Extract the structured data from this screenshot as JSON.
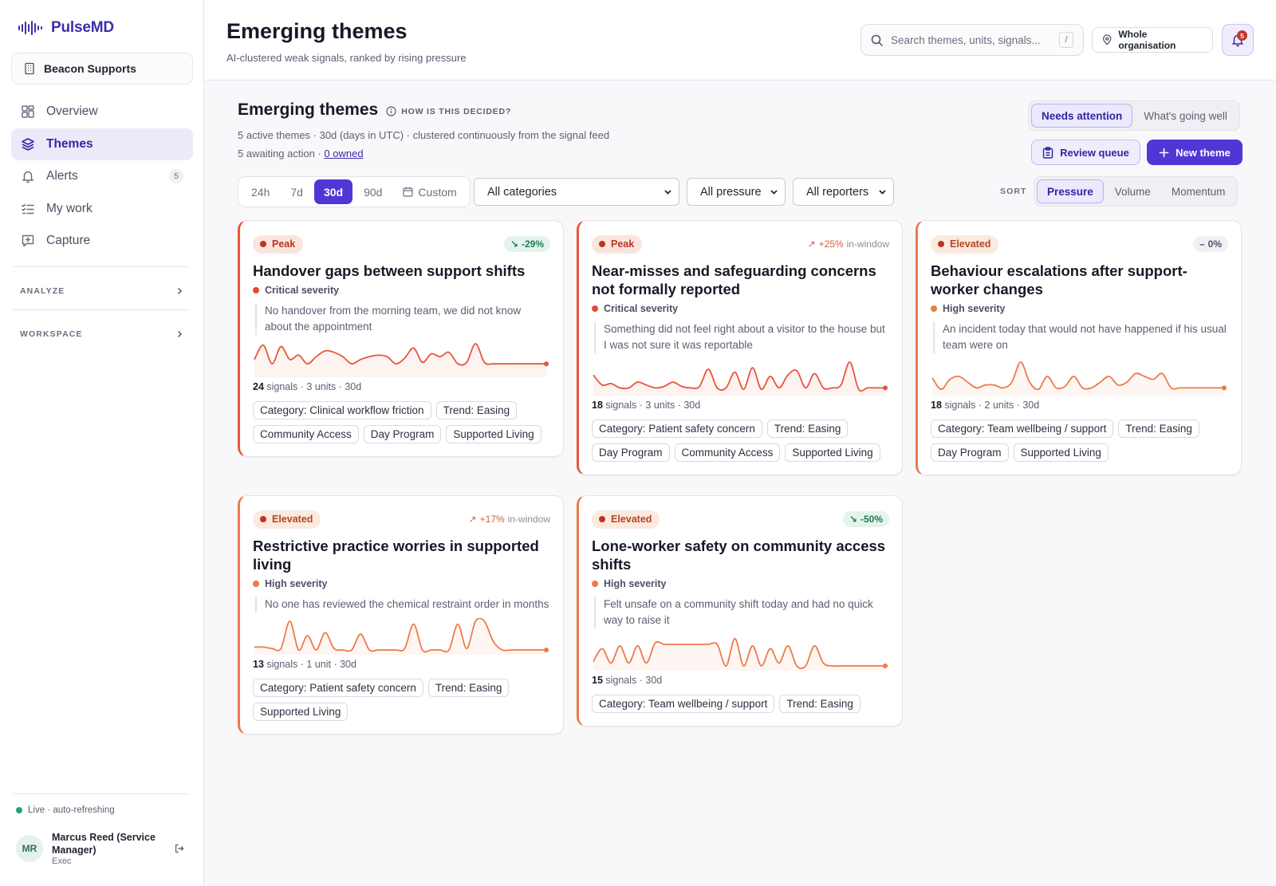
{
  "app": {
    "name": "PulseMD",
    "org": "Beacon Supports"
  },
  "sidebar": {
    "items": [
      {
        "label": "Overview",
        "icon": "dashboard-icon",
        "active": false
      },
      {
        "label": "Themes",
        "icon": "layers-icon",
        "active": true
      },
      {
        "label": "Alerts",
        "icon": "bell-icon",
        "badge": "5",
        "active": false
      },
      {
        "label": "My work",
        "icon": "checklist-icon",
        "active": false
      },
      {
        "label": "Capture",
        "icon": "message-plus-icon",
        "active": false
      }
    ],
    "sections": [
      "ANALYZE",
      "WORKSPACE"
    ],
    "live_status": "Live · auto-refreshing",
    "user": {
      "initials": "MR",
      "name": "Marcus Reed (Service Manager)",
      "role": "Exec"
    }
  },
  "header": {
    "title": "Emerging themes",
    "subtitle": "AI-clustered weak signals, ranked by rising pressure",
    "search_placeholder": "Search themes, units, signals...",
    "search_shortcut": "/",
    "scope": "Whole organisation",
    "notifications": "5"
  },
  "main": {
    "title": "Emerging themes",
    "how_link": "HOW IS THIS DECIDED?",
    "meta_line": "5 active themes · 30d (days in UTC) · clustered continuously from the signal feed",
    "awaiting": "5 awaiting action · ",
    "owned_link": "0 owned",
    "view_toggle": [
      "Needs attention",
      "What's going well"
    ],
    "review_button": "Review queue",
    "new_button": "New theme",
    "ranges": [
      "24h",
      "7d",
      "30d",
      "90d",
      "Custom"
    ],
    "active_range": "30d",
    "filters": {
      "category": "All categories",
      "pressure": "All pressure",
      "reporters": "All reporters"
    },
    "sort_label": "SORT",
    "sort_options": [
      "Pressure",
      "Volume",
      "Momentum"
    ]
  },
  "cards": [
    {
      "level": "Peak",
      "trend": "-29%",
      "trend_dir": "down",
      "title": "Handover gaps between support shifts",
      "severity": "Critical severity",
      "quote": "No handover from the morning team, we did not know about the appointment",
      "signals": "24",
      "stats_rest": " signals · 3 units · 30d",
      "tags": [
        "Category: Clinical workflow friction",
        "Trend: Easing",
        "Community Access",
        "Day Program",
        "Supported Living"
      ],
      "spark": [
        0.45,
        0.95,
        0.3,
        0.9,
        0.45,
        0.6,
        0.3,
        0.55,
        0.75,
        0.7,
        0.55,
        0.3,
        0.45,
        0.55,
        0.6,
        0.55,
        0.3,
        0.5,
        0.85,
        0.35,
        0.65,
        0.55,
        0.7,
        0.3,
        0.35,
        1.0,
        0.35,
        0.3,
        0.3,
        0.3,
        0.3,
        0.3,
        0.3,
        0.3
      ]
    },
    {
      "level": "Peak",
      "trend": "+25%",
      "trend_note": "in-window",
      "trend_dir": "up",
      "title": "Near-misses and safeguarding concerns not formally reported",
      "severity": "Critical severity",
      "quote": "Something did not feel right about a visitor to the house but I was not sure it was reportable",
      "signals": "18",
      "stats_rest": " signals · 3 units · 30d",
      "tags": [
        "Category: Patient safety concern",
        "Trend: Easing",
        "Day Program",
        "Community Access",
        "Supported Living"
      ],
      "spark": [
        0.55,
        0.2,
        0.25,
        0.1,
        0.1,
        0.3,
        0.2,
        0.1,
        0.15,
        0.3,
        0.15,
        0.1,
        0.15,
        0.75,
        0.1,
        0.1,
        0.65,
        0.05,
        0.8,
        0.05,
        0.5,
        0.1,
        0.55,
        0.7,
        0.1,
        0.6,
        0.1,
        0.1,
        0.2,
        1.0,
        0.05,
        0.1,
        0.1,
        0.1
      ]
    },
    {
      "level": "Elevated",
      "trend": "0%",
      "trend_dir": "flat",
      "title": "Behaviour escalations after support-worker changes",
      "severity": "High severity",
      "quote": "An incident today that would not have happened if his usual team were on",
      "signals": "18",
      "stats_rest": " signals · 2 units · 30d",
      "tags": [
        "Category: Team wellbeing / support",
        "Trend: Easing",
        "Day Program",
        "Supported Living"
      ],
      "spark": [
        0.45,
        0.05,
        0.4,
        0.5,
        0.3,
        0.1,
        0.2,
        0.2,
        0.1,
        0.3,
        1.0,
        0.3,
        0.05,
        0.5,
        0.1,
        0.15,
        0.5,
        0.1,
        0.1,
        0.3,
        0.5,
        0.2,
        0.3,
        0.6,
        0.5,
        0.4,
        0.6,
        0.1,
        0.1,
        0.1,
        0.1,
        0.1,
        0.1,
        0.1
      ]
    },
    {
      "level": "Elevated",
      "trend": "+17%",
      "trend_note": "in-window",
      "trend_dir": "up",
      "title": "Restrictive practice worries in supported living",
      "severity": "High severity",
      "quote": "No one has reviewed the chemical restraint order in months",
      "signals": "13",
      "stats_rest": " signals · 1 unit · 30d",
      "tags": [
        "Category: Patient safety concern",
        "Trend: Easing",
        "Supported Living"
      ],
      "spark": [
        0.1,
        0.1,
        0.05,
        0.05,
        1.0,
        0.0,
        0.5,
        0.0,
        0.6,
        0.05,
        0.0,
        0.0,
        0.55,
        0.0,
        0.0,
        0.0,
        0.0,
        0.05,
        0.9,
        0.0,
        0.0,
        0.0,
        0.0,
        0.9,
        0.05,
        1.0,
        1.0,
        0.3,
        0.0,
        0.0,
        0.0,
        0.0,
        0.0,
        0.0
      ]
    },
    {
      "level": "Elevated",
      "trend": "-50%",
      "trend_dir": "down",
      "title": "Lone-worker safety on community access shifts",
      "severity": "High severity",
      "quote": "Felt unsafe on a community shift today and had no quick way to raise it",
      "signals": "15",
      "stats_rest": " signals · 30d",
      "tags": [
        "Category: Team wellbeing / support",
        "Trend: Easing"
      ],
      "spark": [
        0.15,
        0.6,
        0.1,
        0.7,
        0.1,
        0.7,
        0.1,
        0.8,
        0.75,
        0.75,
        0.75,
        0.75,
        0.75,
        0.75,
        0.75,
        0.0,
        0.95,
        0.0,
        0.7,
        0.0,
        0.6,
        0.1,
        0.7,
        0.0,
        0.0,
        0.7,
        0.1,
        0.0,
        0.0,
        0.0,
        0.0,
        0.0,
        0.0,
        0.0
      ]
    }
  ],
  "colors": {
    "accent": "#4f37d6",
    "peak": "#e8553a",
    "elevated": "#ee7a4a"
  }
}
